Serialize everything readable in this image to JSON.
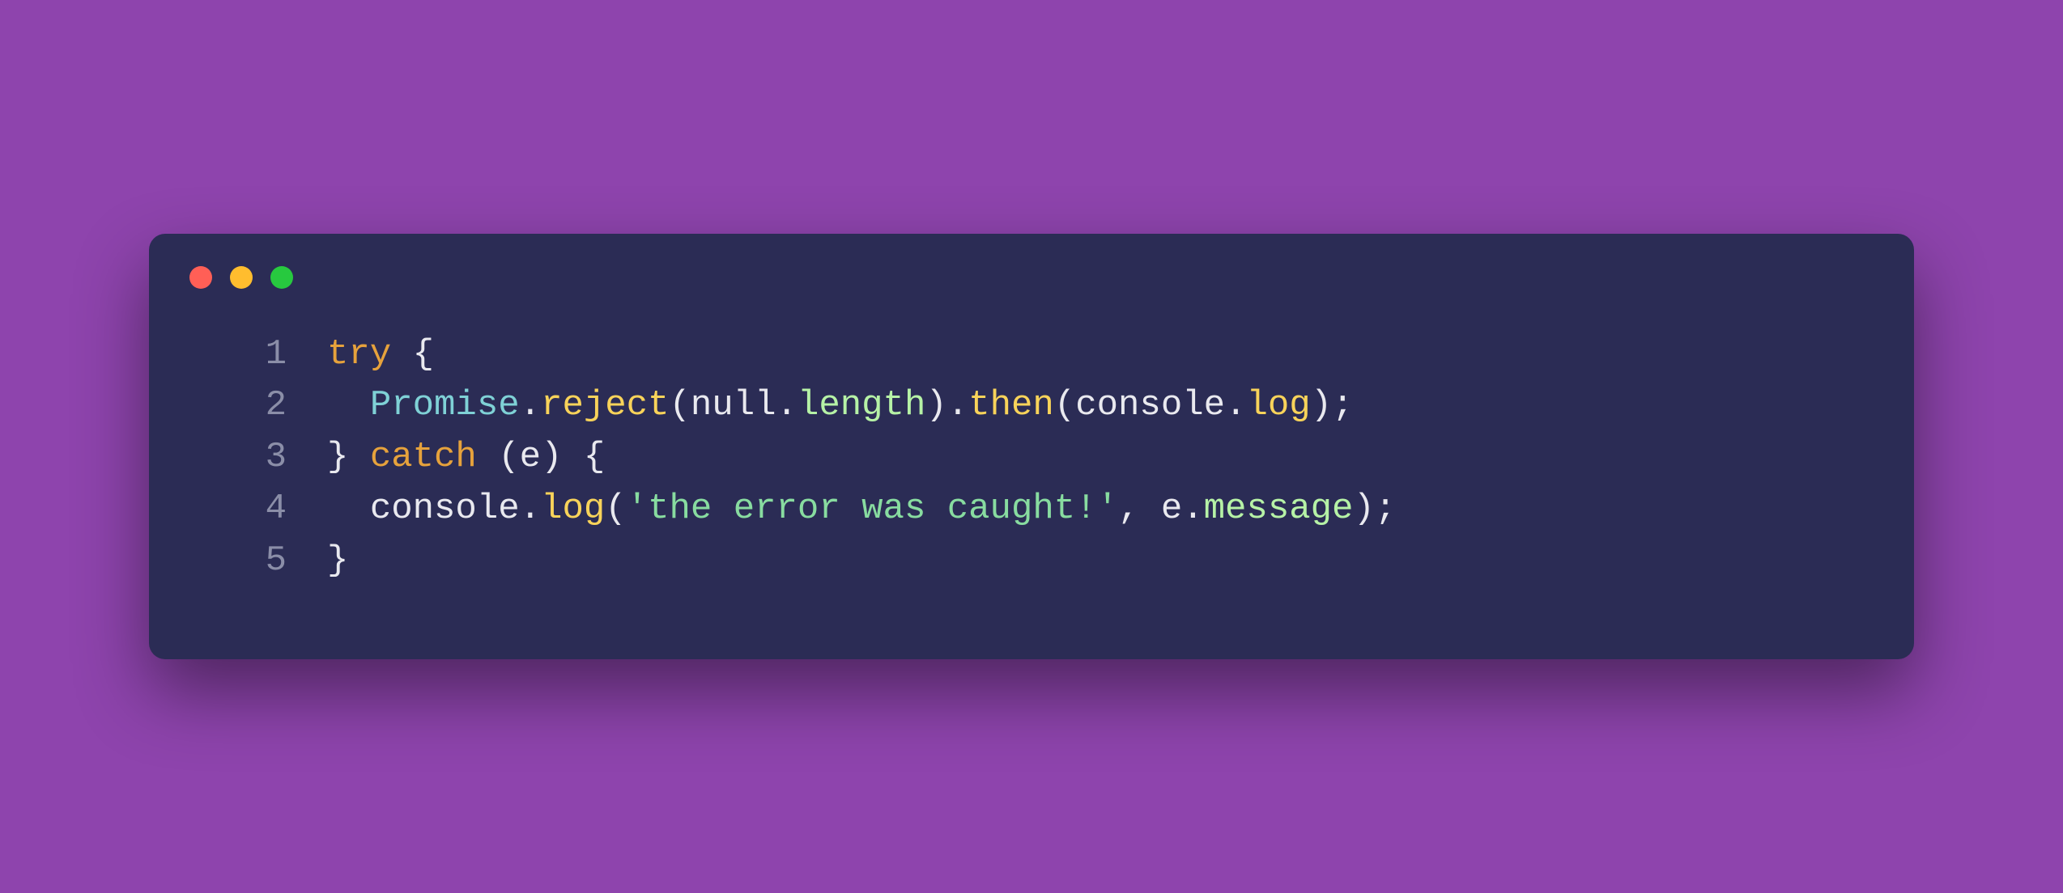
{
  "window": {
    "controls": [
      "close",
      "minimize",
      "zoom"
    ]
  },
  "colors": {
    "background": "#8e44ad",
    "window_bg": "#2b2c55",
    "close": "#ff5f56",
    "minimize": "#ffbd2e",
    "zoom": "#27c93f",
    "line_number": "#8b8ea8",
    "keyword": "#e6a23c",
    "class": "#7fd1d6",
    "method": "#f8d35a",
    "property": "#b6f2a6",
    "string": "#88dca0",
    "default": "#e9e9ef"
  },
  "code": {
    "language": "javascript",
    "lines": [
      {
        "n": "1",
        "tokens": [
          {
            "t": "try",
            "c": "kw"
          },
          {
            "t": " {",
            "c": "default"
          }
        ]
      },
      {
        "n": "2",
        "tokens": [
          {
            "t": "  ",
            "c": "default"
          },
          {
            "t": "Promise",
            "c": "class"
          },
          {
            "t": ".",
            "c": "default"
          },
          {
            "t": "reject",
            "c": "method"
          },
          {
            "t": "(",
            "c": "default"
          },
          {
            "t": "null",
            "c": "null"
          },
          {
            "t": ".",
            "c": "default"
          },
          {
            "t": "length",
            "c": "prop"
          },
          {
            "t": ").",
            "c": "default"
          },
          {
            "t": "then",
            "c": "method"
          },
          {
            "t": "(",
            "c": "default"
          },
          {
            "t": "console",
            "c": "obj"
          },
          {
            "t": ".",
            "c": "default"
          },
          {
            "t": "log",
            "c": "method"
          },
          {
            "t": ");",
            "c": "default"
          }
        ]
      },
      {
        "n": "3",
        "tokens": [
          {
            "t": "} ",
            "c": "default"
          },
          {
            "t": "catch",
            "c": "kw"
          },
          {
            "t": " (",
            "c": "default"
          },
          {
            "t": "e",
            "c": "obj"
          },
          {
            "t": ") {",
            "c": "default"
          }
        ]
      },
      {
        "n": "4",
        "tokens": [
          {
            "t": "  ",
            "c": "default"
          },
          {
            "t": "console",
            "c": "obj"
          },
          {
            "t": ".",
            "c": "default"
          },
          {
            "t": "log",
            "c": "method"
          },
          {
            "t": "(",
            "c": "default"
          },
          {
            "t": "'the error was caught!'",
            "c": "str"
          },
          {
            "t": ", ",
            "c": "default"
          },
          {
            "t": "e",
            "c": "obj"
          },
          {
            "t": ".",
            "c": "default"
          },
          {
            "t": "message",
            "c": "prop"
          },
          {
            "t": ");",
            "c": "default"
          }
        ]
      },
      {
        "n": "5",
        "tokens": [
          {
            "t": "}",
            "c": "default"
          }
        ]
      }
    ]
  }
}
